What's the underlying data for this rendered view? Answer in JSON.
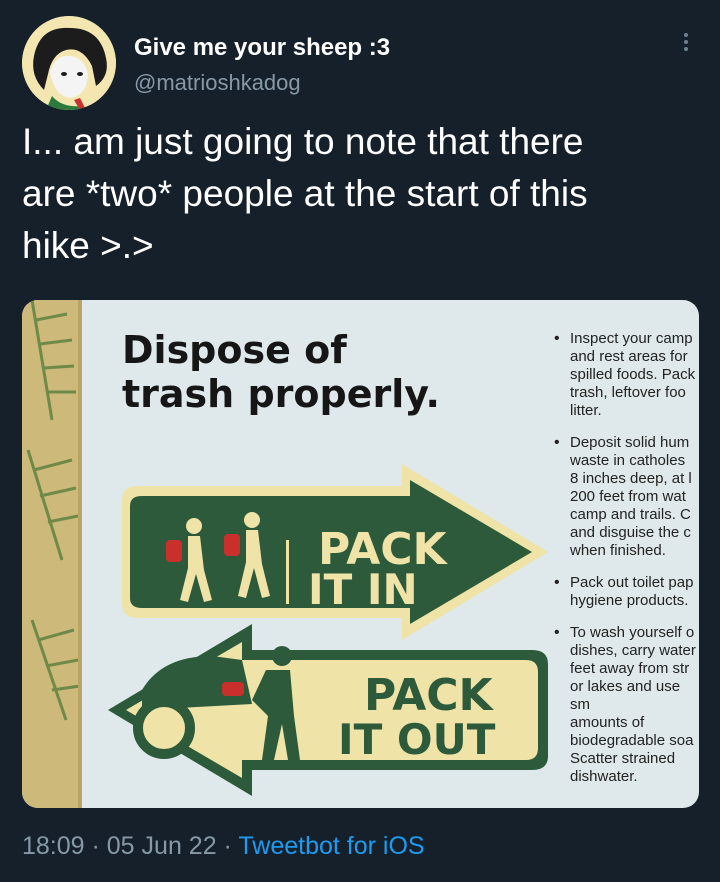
{
  "author": {
    "display_name": "Give me your sheep :3",
    "handle": "@matrioshkadog"
  },
  "tweet": {
    "text": "I... am just going to note that there\nare *two* people at the start of this\nhike >.>"
  },
  "sign": {
    "title_line1": "Dispose of",
    "title_line2": "trash properly.",
    "pack_in_1": "PACK",
    "pack_in_2": "IT IN",
    "pack_out_1": "PACK",
    "pack_out_2": "IT OUT",
    "bullets": [
      "Inspect your camp\nand rest areas for\nspilled foods. Pack\ntrash, leftover foo\nlitter.",
      "Deposit solid hum\nwaste in catholes\n8 inches deep, at l\n200 feet from wat\ncamp and trails. C\nand disguise the c\nwhen finished.",
      "Pack out toilet pap\nhygiene products.",
      "To wash yourself o\ndishes, carry water\nfeet away from str\nor lakes and use sm\namounts of\nbiodegradable soa\nScatter strained\ndishwater."
    ],
    "colors": {
      "green": "#2c5a3a",
      "cream": "#efe3a7",
      "panel": "#dfe9ec",
      "red": "#c9302c"
    }
  },
  "meta": {
    "time": "18:09",
    "sep1": " · ",
    "date": "05 Jun 22",
    "sep2": " · ",
    "source": "Tweetbot for iOS"
  },
  "icons": [
    "avatar",
    "more-options-icon",
    "hiker-icon",
    "car-icon",
    "fern-icon"
  ]
}
